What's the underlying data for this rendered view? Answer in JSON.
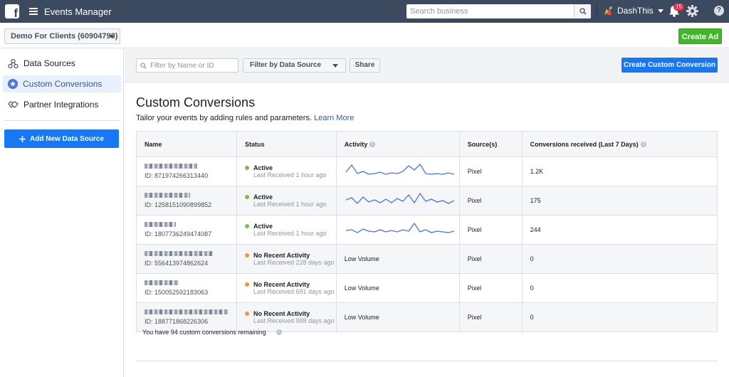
{
  "topbar": {
    "app_title": "Events Manager",
    "search_placeholder": "Search business",
    "account_name": "DashThis",
    "notification_count": "15",
    "help_label": "?"
  },
  "subbar": {
    "ad_account": "Demo For Clients (60904793)",
    "create_ad_label": "Create Ad"
  },
  "sidebar": {
    "items": [
      {
        "label": "Data Sources",
        "icon": "data-sources-icon"
      },
      {
        "label": "Custom Conversions",
        "icon": "star-icon",
        "active": true
      },
      {
        "label": "Partner Integrations",
        "icon": "handshake-icon"
      }
    ],
    "add_source_label": "Add New Data Source"
  },
  "toolbar": {
    "filter_placeholder": "Filter by Name or ID",
    "filter_source_label": "Filter by Data Source",
    "share_label": "Share",
    "create_custom_label": "Create Custom Conversion"
  },
  "main": {
    "title": "Custom Conversions",
    "subtitle": "Tailor your events by adding rules and parameters.",
    "learn_more": "Learn More",
    "remaining_text": "You have 94 custom conversions remaining"
  },
  "table": {
    "headers": [
      "Name",
      "Status",
      "Activity",
      "Source(s)",
      "Conversions received (Last 7 Days)"
    ],
    "rows": [
      {
        "id": "ID: 871974266313440",
        "status": "Active",
        "status_sub": "Last Received 1 hour ago",
        "status_color": "#7ac143",
        "activity": "",
        "source": "Pixel",
        "conversions": "1.2K"
      },
      {
        "id": "ID: 1258151090899852",
        "status": "Active",
        "status_sub": "Last Received 1 hour ago",
        "status_color": "#7ac143",
        "activity": "",
        "source": "Pixel",
        "conversions": "175"
      },
      {
        "id": "ID: 1807736249474087",
        "status": "Active",
        "status_sub": "Last Received 1 hour ago",
        "status_color": "#7ac143",
        "activity": "",
        "source": "Pixel",
        "conversions": "244"
      },
      {
        "id": "ID: 556413974862624",
        "status": "No Recent Activity",
        "status_sub": "Last Received 228 days ago",
        "status_color": "#f7923a",
        "activity": "Low Volume",
        "source": "Pixel",
        "conversions": "0"
      },
      {
        "id": "ID: 150052592183063",
        "status": "No Recent Activity",
        "status_sub": "Last Received 691 days ago",
        "status_color": "#f7923a",
        "activity": "Low Volume",
        "source": "Pixel",
        "conversions": "0"
      },
      {
        "id": "ID: 188771868226306",
        "status": "No Recent Activity",
        "status_sub": "Last Received 998 days ago",
        "status_color": "#f7923a",
        "activity": "Low Volume",
        "source": "Pixel",
        "conversions": "0"
      }
    ]
  },
  "colors": {
    "topbar": "#3b4a5e",
    "primary": "#1877f2",
    "green": "#42b72a",
    "sparkline": "#4a76d4"
  }
}
